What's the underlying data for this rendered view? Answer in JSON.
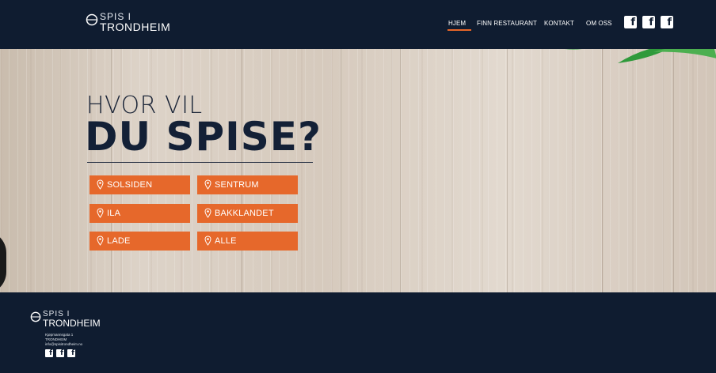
{
  "header": {
    "logo_line1": "SPIS I",
    "logo_line2": "TRONDHEIM",
    "nav": [
      "HJEM",
      "FINN RESTAURANT",
      "KONTAKT",
      "OM OSS"
    ],
    "active_nav": "HJEM",
    "social_icons": [
      "facebook-icon",
      "facebook-icon",
      "facebook-icon"
    ]
  },
  "hero": {
    "subtitle": "HVOR VIL",
    "title": "DU SPISE?",
    "areas": [
      "SOLSIDEN",
      "SENTRUM",
      "ILA",
      "BAKKLANDET",
      "LADE",
      "ALLE"
    ]
  },
  "footer": {
    "logo_line1": "SPIS I",
    "logo_line2": "TRONDHEIM",
    "address_line1": "Kjøpmannsgata 1",
    "address_line2": "TRONDHEIM",
    "email": "info@spisitrondheim.no",
    "social_icons": [
      "facebook-icon",
      "facebook-icon",
      "facebook-icon"
    ]
  },
  "colors": {
    "navy": "#0f1c30",
    "accent_orange": "#e6682b"
  }
}
